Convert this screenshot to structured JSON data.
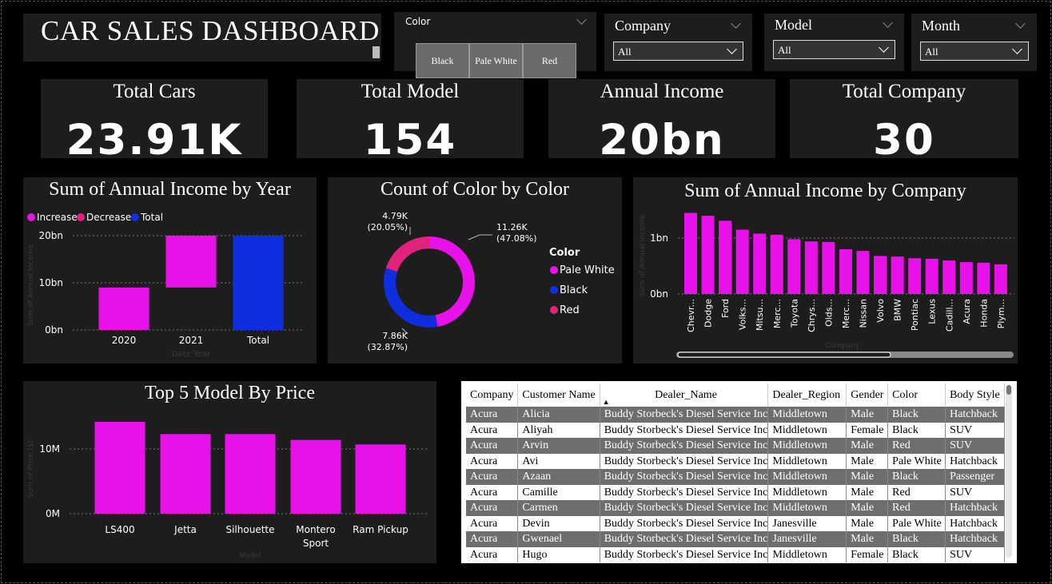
{
  "header": {
    "title": "CAR SALES DASHBOARD"
  },
  "slicers": {
    "color": {
      "label": "Color",
      "options": [
        "Black",
        "Pale White",
        "Red"
      ]
    },
    "company": {
      "label": "Company",
      "value": "All"
    },
    "model": {
      "label": "Model",
      "value": "All"
    },
    "month": {
      "label": "Month",
      "value": "All"
    }
  },
  "kpis": [
    {
      "title": "Total Cars",
      "value": "23.91K"
    },
    {
      "title": "Total Model",
      "value": "154"
    },
    {
      "title": "Annual Income",
      "value": "20bn"
    },
    {
      "title": "Total Company",
      "value": "30"
    }
  ],
  "colors": {
    "magenta": "#e911e9",
    "blue": "#0e2ee0",
    "pink": "#e1237d",
    "panel": "#1d1d1d"
  },
  "chart_data": [
    {
      "type": "waterfall",
      "title": "Sum of Annual Income by Year",
      "legend": [
        "Increase",
        "Decrease",
        "Total"
      ],
      "legend_position": "top-left",
      "categories": [
        "2020",
        "2021",
        "Total"
      ],
      "values": [
        9,
        11,
        20
      ],
      "kinds": [
        "increase",
        "increase",
        "total"
      ],
      "ytick_labels": [
        "0bn",
        "10bn",
        "20bn"
      ],
      "ylim": [
        0,
        20
      ],
      "xlabel": "Date Year",
      "ylabel": "Sum of Annual Income",
      "grid": true
    },
    {
      "type": "pie",
      "title": "Count of Color by Color",
      "legend_title": "Color",
      "legend_position": "right",
      "categories": [
        "Pale White",
        "Black",
        "Red"
      ],
      "values": [
        11.26,
        7.86,
        4.79
      ],
      "labels": [
        "11.26K",
        "7.86K",
        "4.79K"
      ],
      "percents": [
        "(47.08%)",
        "(32.87%)",
        "(20.05%)"
      ]
    },
    {
      "type": "bar",
      "title": "Sum of Annual Income by Company",
      "categories": [
        "Chevr...",
        "Dodge",
        "Ford",
        "Volks...",
        "Mitsu...",
        "Merc...",
        "Toyota",
        "Chrys...",
        "Olds...",
        "Merc...",
        "Nissan",
        "Volvo",
        "BMW",
        "Pontiac",
        "Lexus",
        "Cadill...",
        "Acura",
        "Honda",
        "Plym..."
      ],
      "values": [
        1.45,
        1.4,
        1.31,
        1.15,
        1.08,
        1.06,
        0.98,
        0.94,
        0.93,
        0.8,
        0.77,
        0.68,
        0.67,
        0.64,
        0.63,
        0.6,
        0.57,
        0.56,
        0.53
      ],
      "ytick_labels": [
        "0bn",
        "1bn"
      ],
      "ylim": [
        0,
        1.6
      ],
      "xlabel": "Company",
      "ylabel": "Sum of Annual Income",
      "grid": true
    },
    {
      "type": "bar",
      "title": "Top 5 Model By Price",
      "categories": [
        "LS400",
        "Jetta",
        "Silhouette",
        "Montero Sport",
        "Ram Pickup"
      ],
      "category_lines": [
        [
          "LS400"
        ],
        [
          "Jetta"
        ],
        [
          "Silhouette"
        ],
        [
          "Montero",
          "Sport"
        ],
        [
          "Ram Pickup"
        ]
      ],
      "values": [
        14.2,
        12.3,
        12.3,
        11.4,
        10.7
      ],
      "ytick_labels": [
        "0M",
        "10M"
      ],
      "ylim": [
        0,
        16
      ],
      "xlabel": "Model",
      "ylabel": "Sum of Price ($)",
      "grid": true
    },
    {
      "type": "table",
      "columns": [
        "Company",
        "Customer Name",
        "Dealer_Name",
        "Dealer_Region",
        "Gender",
        "Color",
        "Body Style"
      ],
      "rows": [
        [
          "Acura",
          "Alicia",
          "Buddy Storbeck's Diesel Service Inc",
          "Middletown",
          "Male",
          "Black",
          "Hatchback"
        ],
        [
          "Acura",
          "Aliyah",
          "Buddy Storbeck's Diesel Service Inc",
          "Middletown",
          "Female",
          "Black",
          "SUV"
        ],
        [
          "Acura",
          "Arvin",
          "Buddy Storbeck's Diesel Service Inc",
          "Middletown",
          "Male",
          "Red",
          "SUV"
        ],
        [
          "Acura",
          "Avi",
          "Buddy Storbeck's Diesel Service Inc",
          "Middletown",
          "Male",
          "Pale White",
          "Hatchback"
        ],
        [
          "Acura",
          "Azaan",
          "Buddy Storbeck's Diesel Service Inc",
          "Middletown",
          "Male",
          "Black",
          "Passenger"
        ],
        [
          "Acura",
          "Camille",
          "Buddy Storbeck's Diesel Service Inc",
          "Middletown",
          "Male",
          "Red",
          "SUV"
        ],
        [
          "Acura",
          "Carmen",
          "Buddy Storbeck's Diesel Service Inc",
          "Middletown",
          "Male",
          "Red",
          "Hatchback"
        ],
        [
          "Acura",
          "Devin",
          "Buddy Storbeck's Diesel Service Inc",
          "Janesville",
          "Male",
          "Pale White",
          "Hatchback"
        ],
        [
          "Acura",
          "Gwenael",
          "Buddy Storbeck's Diesel Service Inc",
          "Janesville",
          "Male",
          "Black",
          "Hatchback"
        ],
        [
          "Acura",
          "Hugo",
          "Buddy Storbeck's Diesel Service Inc",
          "Middletown",
          "Female",
          "Black",
          "SUV"
        ]
      ]
    }
  ]
}
